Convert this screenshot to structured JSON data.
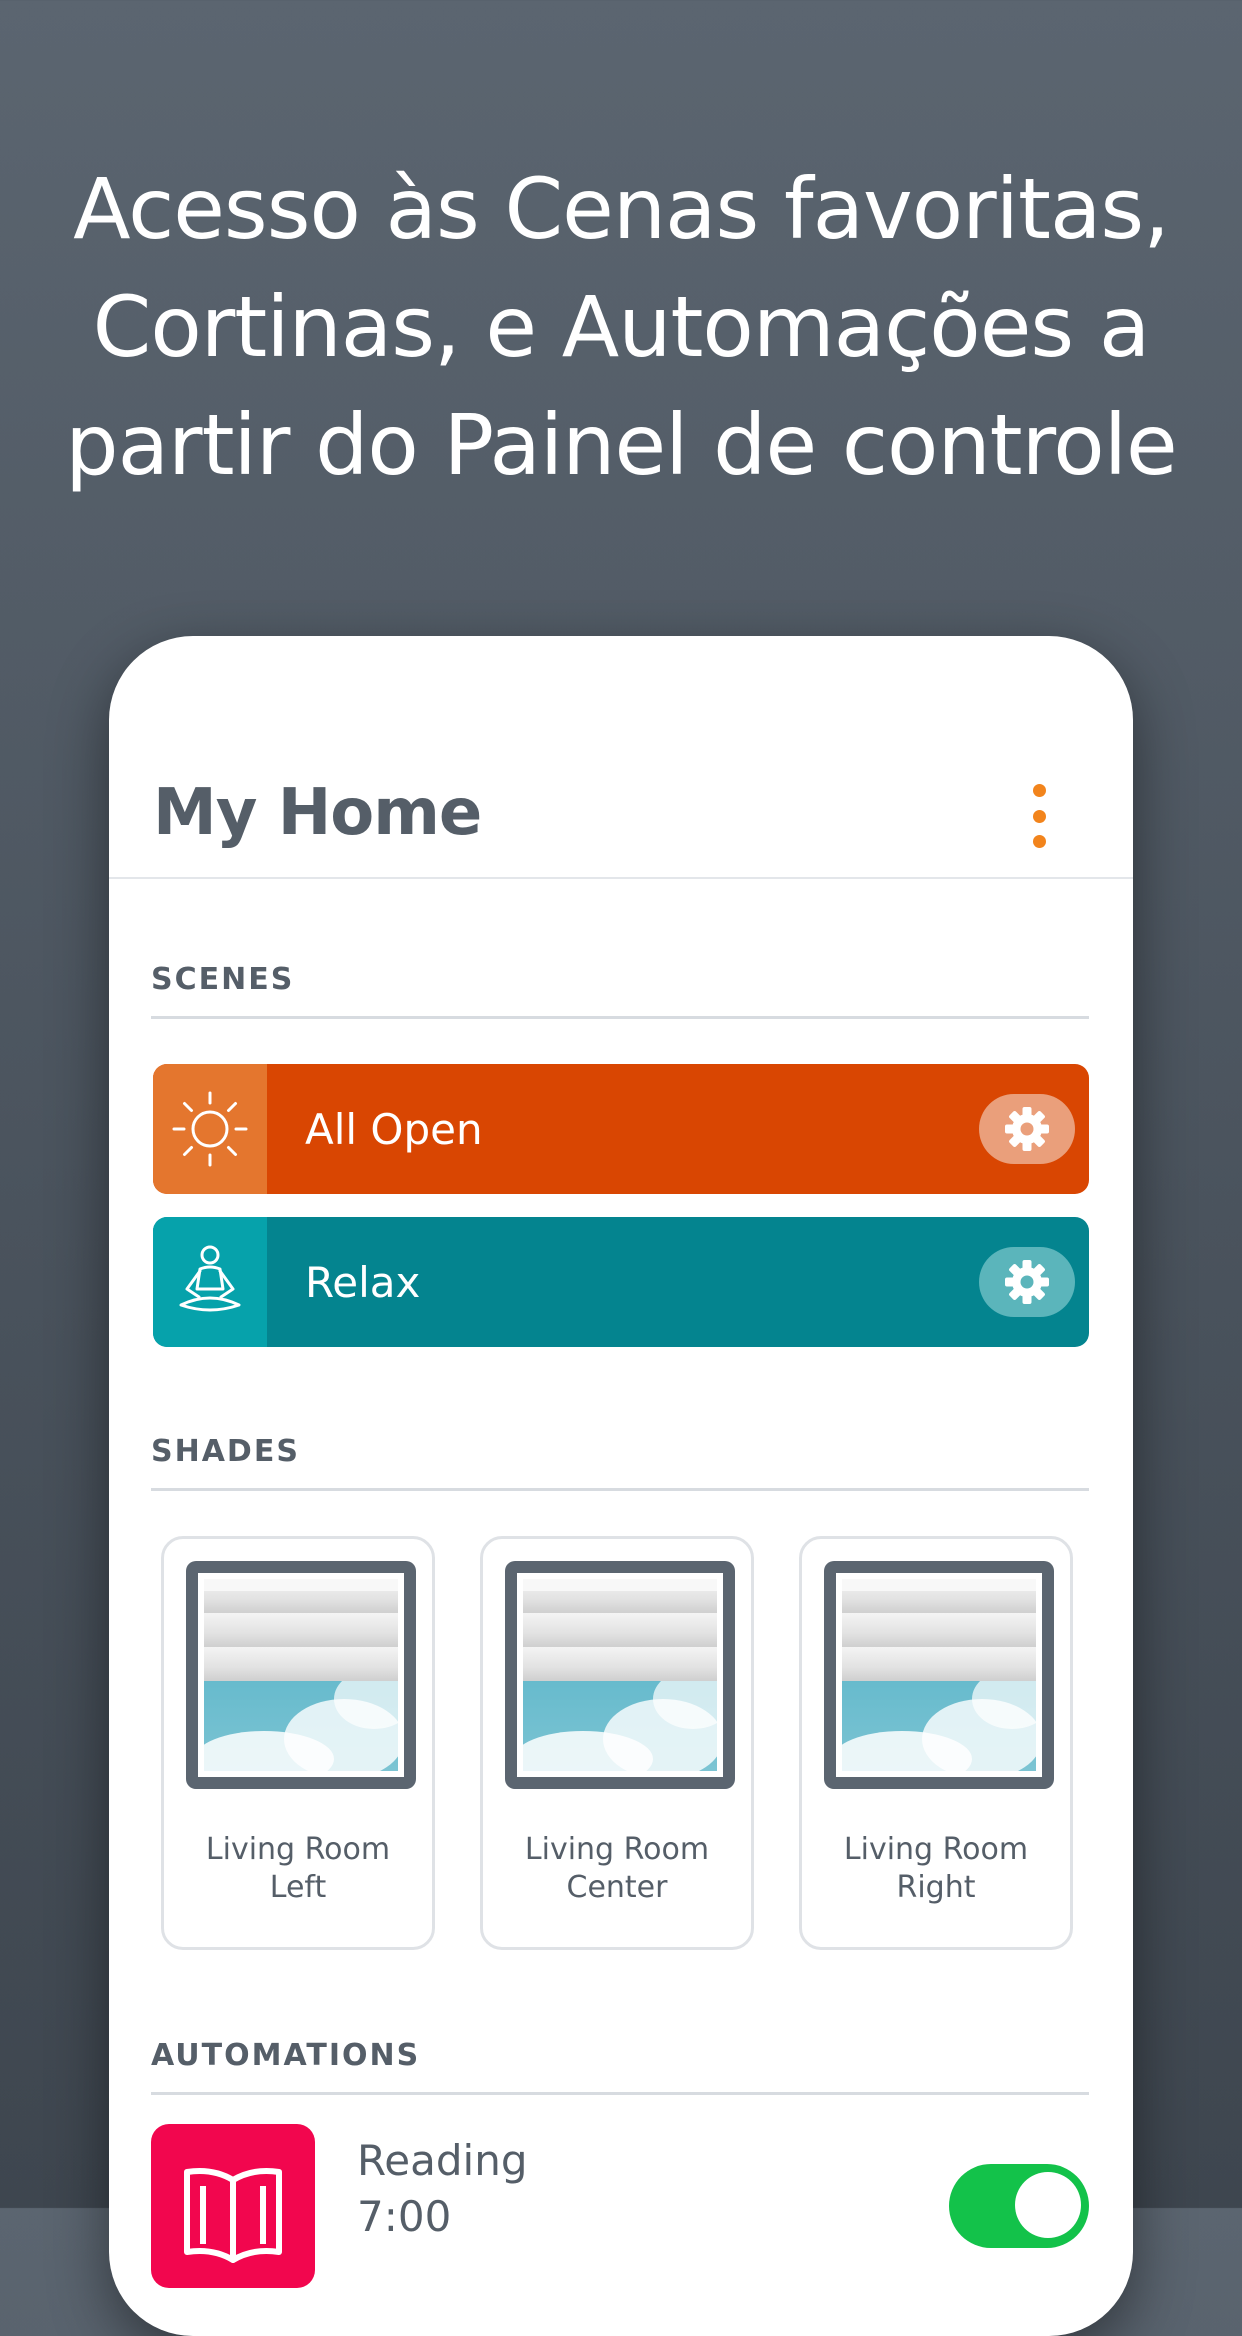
{
  "headline": {
    "line1": "Acesso às Cenas favoritas,",
    "line2": "Cortinas, e Automações a",
    "line3": "partir do Painel de controle"
  },
  "header": {
    "title": "My Home",
    "menu_icon": "more-vertical-icon",
    "accent_color": "#f2841c"
  },
  "scenes": {
    "section_label": "SCENES",
    "items": [
      {
        "label": "All Open",
        "icon": "sun-icon",
        "settings_icon": "gear-icon",
        "color": "#d94602"
      },
      {
        "label": "Relax",
        "icon": "meditation-icon",
        "settings_icon": "gear-icon",
        "color": "#04848f"
      }
    ]
  },
  "shades": {
    "section_label": "SHADES",
    "items": [
      {
        "line1": "Living Room",
        "line2": "Left",
        "icon": "window-shade-icon"
      },
      {
        "line1": "Living Room",
        "line2": "Center",
        "icon": "window-shade-icon"
      },
      {
        "line1": "Living Room",
        "line2": "Right",
        "icon": "window-shade-icon"
      }
    ]
  },
  "automations": {
    "section_label": "AUTOMATIONS",
    "items": [
      {
        "label": "Reading",
        "sublabel": "7:00",
        "icon": "book-icon",
        "enabled": true,
        "color": "#f2064e"
      }
    ]
  }
}
